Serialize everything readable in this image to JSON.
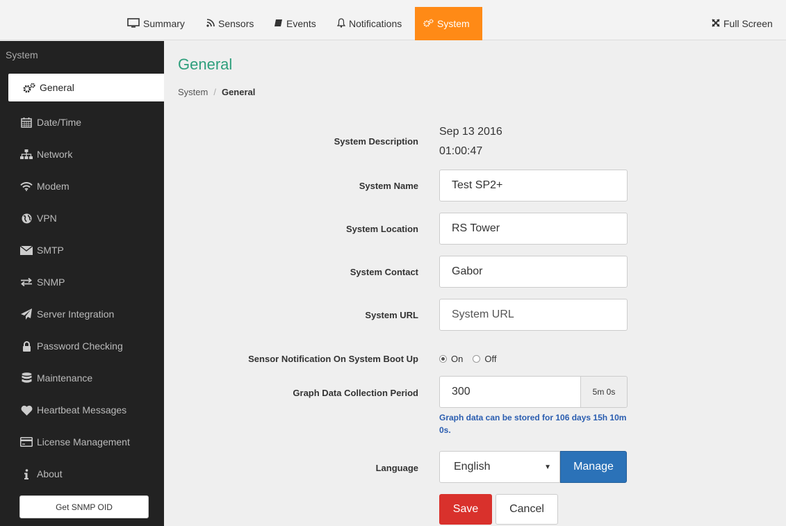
{
  "topnav": {
    "tabs": [
      {
        "label": "Summary",
        "icon": "monitor-icon"
      },
      {
        "label": "Sensors",
        "icon": "rss-icon"
      },
      {
        "label": "Events",
        "icon": "book-icon"
      },
      {
        "label": "Notifications",
        "icon": "bell-icon"
      },
      {
        "label": "System",
        "icon": "gears-icon",
        "active": true
      }
    ],
    "fullscreen_label": "Full Screen",
    "active_color": "#ff8a16"
  },
  "sidebar": {
    "heading": "System",
    "items": [
      {
        "label": "General",
        "icon": "gears-icon",
        "active": true
      },
      {
        "label": "Date/Time",
        "icon": "calendar-icon"
      },
      {
        "label": "Network",
        "icon": "sitemap-icon"
      },
      {
        "label": "Modem",
        "icon": "wifi-icon"
      },
      {
        "label": "VPN",
        "icon": "globe-icon"
      },
      {
        "label": "SMTP",
        "icon": "envelope-icon"
      },
      {
        "label": "SNMP",
        "icon": "exchange-icon"
      },
      {
        "label": "Server Integration",
        "icon": "paper-plane-icon"
      },
      {
        "label": "Password Checking",
        "icon": "lock-icon"
      },
      {
        "label": "Maintenance",
        "icon": "database-icon"
      },
      {
        "label": "Heartbeat Messages",
        "icon": "heart-icon"
      },
      {
        "label": "License Management",
        "icon": "credit-card-icon"
      },
      {
        "label": "About",
        "icon": "info-icon"
      }
    ],
    "snmp_button": "Get SNMP OID"
  },
  "main": {
    "title": "General",
    "breadcrumb": {
      "parent": "System",
      "separator": "/",
      "current": "General"
    },
    "fields": {
      "description": {
        "label": "System Description",
        "line1": "Sep 13 2016",
        "line2": "01:00:47"
      },
      "name": {
        "label": "System Name",
        "value": "Test SP2+"
      },
      "location": {
        "label": "System Location",
        "value": "RS Tower"
      },
      "contact": {
        "label": "System Contact",
        "value": "Gabor"
      },
      "url": {
        "label": "System URL",
        "placeholder": "System URL"
      },
      "boot_notification": {
        "label": "Sensor Notification On System Boot Up",
        "options": [
          "On",
          "Off"
        ],
        "selected": "On"
      },
      "graph_period": {
        "label": "Graph Data Collection Period",
        "value": "300",
        "addon": "5m 0s",
        "help": "Graph data can be stored for 106 days 15h 10m 0s."
      },
      "language": {
        "label": "Language",
        "value": "English",
        "manage_label": "Manage"
      }
    },
    "save_label": "Save",
    "cancel_label": "Cancel"
  }
}
